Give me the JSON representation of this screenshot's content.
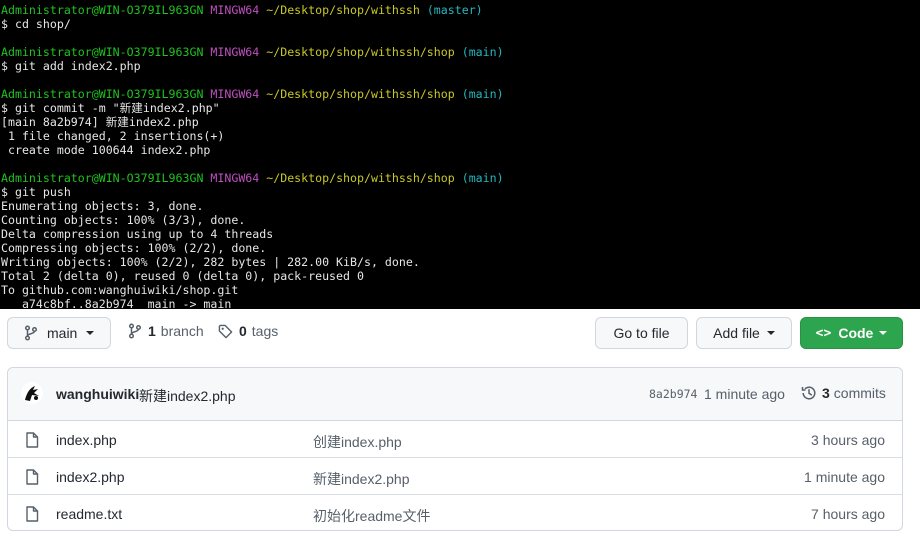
{
  "terminal": {
    "lines": [
      [
        {
          "t": "Administrator@WIN-O379IL963GN",
          "c": "user"
        },
        {
          "t": " "
        },
        {
          "t": "MINGW64",
          "c": "sys"
        },
        {
          "t": " "
        },
        {
          "t": "~/Desktop/shop/withssh",
          "c": "path"
        },
        {
          "t": " "
        },
        {
          "t": "(master)",
          "c": "branch"
        }
      ],
      [
        {
          "t": "$ cd shop/"
        }
      ],
      [
        {
          "t": ""
        }
      ],
      [
        {
          "t": "Administrator@WIN-O379IL963GN",
          "c": "user"
        },
        {
          "t": " "
        },
        {
          "t": "MINGW64",
          "c": "sys"
        },
        {
          "t": " "
        },
        {
          "t": "~/Desktop/shop/withssh/shop",
          "c": "path"
        },
        {
          "t": " "
        },
        {
          "t": "(main)",
          "c": "branch"
        }
      ],
      [
        {
          "t": "$ git add index2.php"
        }
      ],
      [
        {
          "t": ""
        }
      ],
      [
        {
          "t": "Administrator@WIN-O379IL963GN",
          "c": "user"
        },
        {
          "t": " "
        },
        {
          "t": "MINGW64",
          "c": "sys"
        },
        {
          "t": " "
        },
        {
          "t": "~/Desktop/shop/withssh/shop",
          "c": "path"
        },
        {
          "t": " "
        },
        {
          "t": "(main)",
          "c": "branch"
        }
      ],
      [
        {
          "t": "$ git commit -m \"新建index2.php\""
        }
      ],
      [
        {
          "t": "[main 8a2b974] 新建index2.php"
        }
      ],
      [
        {
          "t": " 1 file changed, 2 insertions(+)"
        }
      ],
      [
        {
          "t": " create mode 100644 index2.php"
        }
      ],
      [
        {
          "t": ""
        }
      ],
      [
        {
          "t": "Administrator@WIN-O379IL963GN",
          "c": "user"
        },
        {
          "t": " "
        },
        {
          "t": "MINGW64",
          "c": "sys"
        },
        {
          "t": " "
        },
        {
          "t": "~/Desktop/shop/withssh/shop",
          "c": "path"
        },
        {
          "t": " "
        },
        {
          "t": "(main)",
          "c": "branch"
        }
      ],
      [
        {
          "t": "$ git push"
        }
      ],
      [
        {
          "t": "Enumerating objects: 3, done."
        }
      ],
      [
        {
          "t": "Counting objects: 100% (3/3), done."
        }
      ],
      [
        {
          "t": "Delta compression using up to 4 threads"
        }
      ],
      [
        {
          "t": "Compressing objects: 100% (2/2), done."
        }
      ],
      [
        {
          "t": "Writing objects: 100% (2/2), 282 bytes | 282.00 KiB/s, done."
        }
      ],
      [
        {
          "t": "Total 2 (delta 0), reused 0 (delta 0), pack-reused 0"
        }
      ],
      [
        {
          "t": "To github.com:wanghuiwiki/shop.git"
        }
      ],
      [
        {
          "t": "   a74c8bf..8a2b974  main -> main"
        }
      ]
    ]
  },
  "repo": {
    "branch_button": "main",
    "branch_count": "1",
    "branch_word": "branch",
    "tag_count": "0",
    "tag_word": "tags",
    "goto_file": "Go to file",
    "add_file": "Add file",
    "code": "Code",
    "code_glyph": "<>"
  },
  "commit": {
    "author": "wanghuiwiki",
    "message": "新建index2.php",
    "sha": "8a2b974",
    "time": "1 minute ago",
    "commits_count": "3",
    "commits_word": "commits"
  },
  "files": [
    {
      "name": "index.php",
      "message": "创建index.php",
      "time": "3 hours ago"
    },
    {
      "name": "index2.php",
      "message": "新建index2.php",
      "time": "1 minute ago"
    },
    {
      "name": "readme.txt",
      "message": "初始化readme文件",
      "time": "7 hours ago"
    }
  ],
  "colors": {
    "terminal_bg": "#000000",
    "prompt_user": "#1fc21f",
    "prompt_system": "#c04fc0",
    "prompt_path": "#c8c828",
    "prompt_branch": "#25b6c0",
    "code_button": "#2da44e"
  }
}
